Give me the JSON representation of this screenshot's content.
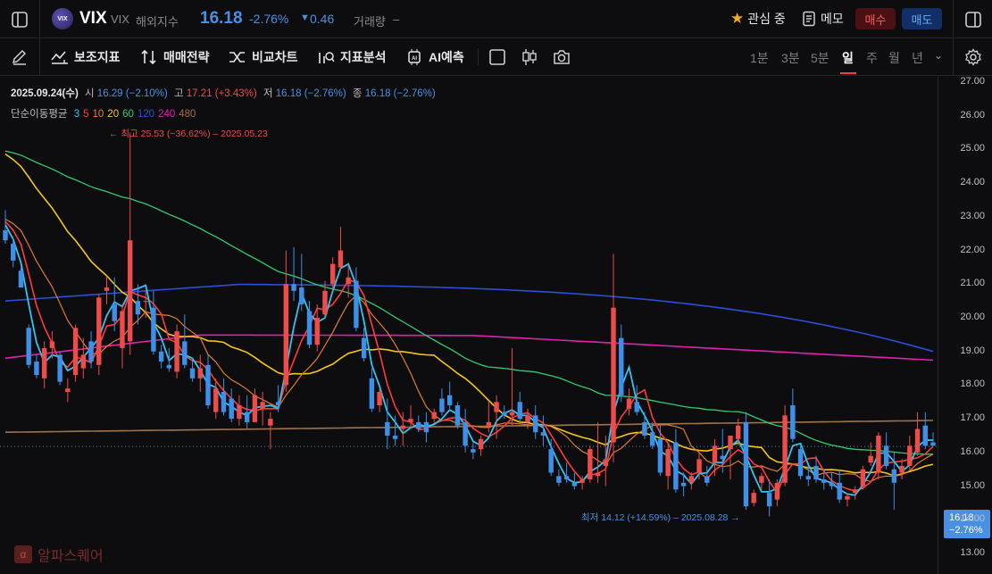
{
  "header": {
    "logo_text": "VIX",
    "symbol": "VIX",
    "symbol_sub": "VIX",
    "market": "해외지수",
    "price": "16.18",
    "change_pct": "-2.76%",
    "change_arrow": "▼",
    "change_abs": "0.46",
    "volume_label": "거래량",
    "volume_value": "–",
    "watch_label": "관심 중",
    "memo_label": "메모",
    "buy_label": "매수",
    "sell_label": "매도"
  },
  "toolbar": {
    "tools": [
      "보조지표",
      "매매전략",
      "비교차트",
      "지표분석",
      "AI예측"
    ],
    "periods": [
      "1분",
      "3분",
      "5분",
      "일",
      "주",
      "월",
      "년"
    ],
    "active_period": "일"
  },
  "ohlc": {
    "date": "2025.09.24(수)",
    "open_label": "시",
    "open": "16.29 (−2.10%)",
    "high_label": "고",
    "high": "17.21 (+3.43%)",
    "low_label": "저",
    "low": "16.18 (−2.76%)",
    "close_label": "종",
    "close": "16.18 (−2.76%)"
  },
  "ma_legend": {
    "label": "단순이동평균",
    "periods": [
      {
        "p": "3",
        "color": "#33c3f0"
      },
      {
        "p": "5",
        "color": "#ff3b3b"
      },
      {
        "p": "10",
        "color": "#e07b30"
      },
      {
        "p": "20",
        "color": "#f5c518"
      },
      {
        "p": "60",
        "color": "#2ecc71"
      },
      {
        "p": "120",
        "color": "#2a4fd8"
      },
      {
        "p": "240",
        "color": "#e020b0"
      },
      {
        "p": "480",
        "color": "#a0724a"
      }
    ]
  },
  "annotations": {
    "high": "← 최고 25.53 (−36.62%) – 2025.05.23",
    "low": "최저 14.12 (+14.59%) – 2025.08.28 →"
  },
  "price_tag": {
    "price": "16.18",
    "pct": "−2.76%"
  },
  "watermark": {
    "logo": "α",
    "text": "알파스퀘어"
  },
  "colors": {
    "up": "#ee4b4b",
    "down": "#3d8fe8",
    "bg": "#0d0d0f"
  },
  "chart_data": {
    "type": "candlestick",
    "y_ticks": [
      "27.00",
      "26.00",
      "25.00",
      "24.00",
      "23.00",
      "22.00",
      "21.00",
      "20.00",
      "19.00",
      "18.00",
      "17.00",
      "16.00",
      "15.00",
      "14.00",
      "13.00"
    ],
    "ylim": [
      12.8,
      27.3
    ],
    "grid": false,
    "candles": [
      [
        22.6,
        23.2,
        22.2,
        22.3
      ],
      [
        22.2,
        22.4,
        21.5,
        21.7
      ],
      [
        21.4,
        21.5,
        20.9,
        20.9
      ],
      [
        19.7,
        19.8,
        18.5,
        18.6
      ],
      [
        18.7,
        18.9,
        18.2,
        18.3
      ],
      [
        18.2,
        19.3,
        17.9,
        19.1
      ],
      [
        19.1,
        19.6,
        18.8,
        19.3
      ],
      [
        18.9,
        19.0,
        18.0,
        18.1
      ],
      [
        17.8,
        18.2,
        17.5,
        17.9
      ],
      [
        18.3,
        19.8,
        18.1,
        19.7
      ],
      [
        18.5,
        19.4,
        18.2,
        18.9
      ],
      [
        19.3,
        19.6,
        18.5,
        18.7
      ],
      [
        18.6,
        20.7,
        18.3,
        20.6
      ],
      [
        20.8,
        21.2,
        20.4,
        20.9
      ],
      [
        20.4,
        21.2,
        19.6,
        19.9
      ],
      [
        19.1,
        20.4,
        18.5,
        20.2
      ],
      [
        19.3,
        25.5,
        18.9,
        22.3
      ],
      [
        20.5,
        21.0,
        19.8,
        20.1
      ],
      [
        20.5,
        20.8,
        20.0,
        20.5
      ],
      [
        20.3,
        20.8,
        18.9,
        19.0
      ],
      [
        19.0,
        19.2,
        18.5,
        18.7
      ],
      [
        18.6,
        19.1,
        18.4,
        18.5
      ],
      [
        18.4,
        19.8,
        18.2,
        19.6
      ],
      [
        19.3,
        20.1,
        18.5,
        18.6
      ],
      [
        18.5,
        18.8,
        18.1,
        18.2
      ],
      [
        18.2,
        18.9,
        17.8,
        18.5
      ],
      [
        18.6,
        18.9,
        17.3,
        17.4
      ],
      [
        17.2,
        18.2,
        17.0,
        17.9
      ],
      [
        17.8,
        18.2,
        17.1,
        17.2
      ],
      [
        17.6,
        17.9,
        16.9,
        17.0
      ],
      [
        17.0,
        17.7,
        16.8,
        17.4
      ],
      [
        17.2,
        17.7,
        16.7,
        16.9
      ],
      [
        16.9,
        17.9,
        16.9,
        17.7
      ],
      [
        17.3,
        17.8,
        16.8,
        17.5
      ],
      [
        16.8,
        17.2,
        16.1,
        17.0
      ],
      [
        17.5,
        18.0,
        17.2,
        17.4
      ],
      [
        18.0,
        22.0,
        17.8,
        21.0
      ],
      [
        21.0,
        22.1,
        20.5,
        20.8
      ],
      [
        20.9,
        21.9,
        20.2,
        20.4
      ],
      [
        20.2,
        20.5,
        19.1,
        19.2
      ],
      [
        19.2,
        20.4,
        19.0,
        20.0
      ],
      [
        20.1,
        21.1,
        20.0,
        20.8
      ],
      [
        21.0,
        21.8,
        20.8,
        21.6
      ],
      [
        21.5,
        22.7,
        21.4,
        22.0
      ],
      [
        21.0,
        21.6,
        20.6,
        21.2
      ],
      [
        21.1,
        21.5,
        19.6,
        19.7
      ],
      [
        19.4,
        19.7,
        18.7,
        18.8
      ],
      [
        18.2,
        18.5,
        17.2,
        17.3
      ],
      [
        17.4,
        17.9,
        17.2,
        17.8
      ],
      [
        16.9,
        17.6,
        16.1,
        16.5
      ],
      [
        16.5,
        17.1,
        16.2,
        16.4
      ],
      [
        16.7,
        17.2,
        16.2,
        16.8
      ],
      [
        16.9,
        17.4,
        16.7,
        17.0
      ],
      [
        16.9,
        17.1,
        16.6,
        16.7
      ],
      [
        16.9,
        17.2,
        16.3,
        16.6
      ],
      [
        17.0,
        17.3,
        16.9,
        17.2
      ],
      [
        17.6,
        17.9,
        17.1,
        17.2
      ],
      [
        17.7,
        18.1,
        17.3,
        17.4
      ],
      [
        17.4,
        17.5,
        16.7,
        16.8
      ],
      [
        16.9,
        17.3,
        16.0,
        16.2
      ],
      [
        16.1,
        16.3,
        15.8,
        16.0
      ],
      [
        16.1,
        16.5,
        15.9,
        16.4
      ],
      [
        16.8,
        17.5,
        16.6,
        16.9
      ],
      [
        17.2,
        17.7,
        16.4,
        17.5
      ],
      [
        17.2,
        17.4,
        17.0,
        17.1
      ],
      [
        17.1,
        19.1,
        16.8,
        17.2
      ],
      [
        17.5,
        17.8,
        16.9,
        17.0
      ],
      [
        16.9,
        17.3,
        16.7,
        17.1
      ],
      [
        17.1,
        17.4,
        16.4,
        16.6
      ],
      [
        16.6,
        17.1,
        16.2,
        16.5
      ],
      [
        16.1,
        16.4,
        15.3,
        15.4
      ],
      [
        15.3,
        15.5,
        15.0,
        15.1
      ],
      [
        15.3,
        15.7,
        15.1,
        15.2
      ],
      [
        15.1,
        15.4,
        14.9,
        15.0
      ],
      [
        15.1,
        15.3,
        14.9,
        15.2
      ],
      [
        15.2,
        16.2,
        15.1,
        16.1
      ],
      [
        15.3,
        16.9,
        15.1,
        15.4
      ],
      [
        15.6,
        16.5,
        15.0,
        15.8
      ],
      [
        16.3,
        21.9,
        15.7,
        20.3
      ],
      [
        19.4,
        19.8,
        17.5,
        17.7
      ],
      [
        17.3,
        17.9,
        17.1,
        17.6
      ],
      [
        17.5,
        18.0,
        17.1,
        17.2
      ],
      [
        16.9,
        17.2,
        16.4,
        16.5
      ],
      [
        16.6,
        16.9,
        16.1,
        16.2
      ],
      [
        16.4,
        16.8,
        15.3,
        15.4
      ],
      [
        15.3,
        16.3,
        14.9,
        16.1
      ],
      [
        16.3,
        16.7,
        14.8,
        14.9
      ],
      [
        15.1,
        15.4,
        14.7,
        15.0
      ],
      [
        15.1,
        15.4,
        14.9,
        15.3
      ],
      [
        15.4,
        16.0,
        15.2,
        15.8
      ],
      [
        15.3,
        15.6,
        15.0,
        15.1
      ],
      [
        15.7,
        16.4,
        15.3,
        16.2
      ],
      [
        15.9,
        16.7,
        15.4,
        15.8
      ],
      [
        16.1,
        16.5,
        15.2,
        16.5
      ],
      [
        16.4,
        17.0,
        16.2,
        16.8
      ],
      [
        16.9,
        17.2,
        14.3,
        14.4
      ],
      [
        14.5,
        14.9,
        14.4,
        14.8
      ],
      [
        15.1,
        15.4,
        14.9,
        15.3
      ],
      [
        14.8,
        15.2,
        14.1,
        14.4
      ],
      [
        14.6,
        15.2,
        14.4,
        15.1
      ],
      [
        15.1,
        17.4,
        15.0,
        17.1
      ],
      [
        17.4,
        17.9,
        16.3,
        16.4
      ],
      [
        16.1,
        16.2,
        15.2,
        15.3
      ],
      [
        15.3,
        15.6,
        15.0,
        15.2
      ],
      [
        15.6,
        15.9,
        15.1,
        15.2
      ],
      [
        15.2,
        15.5,
        14.9,
        15.1
      ],
      [
        15.1,
        15.4,
        14.9,
        15.0
      ],
      [
        15.1,
        15.5,
        14.5,
        14.6
      ],
      [
        14.6,
        14.8,
        14.4,
        14.7
      ],
      [
        14.8,
        15.0,
        14.6,
        14.9
      ],
      [
        15.0,
        15.6,
        14.9,
        15.5
      ],
      [
        15.7,
        16.3,
        15.6,
        15.9
      ],
      [
        15.4,
        16.6,
        15.2,
        16.5
      ],
      [
        16.2,
        16.6,
        15.5,
        15.6
      ],
      [
        15.5,
        16.0,
        14.3,
        15.1
      ],
      [
        15.4,
        15.8,
        15.2,
        15.6
      ],
      [
        15.6,
        16.5,
        15.5,
        16.2
      ],
      [
        16.0,
        17.2,
        15.9,
        16.7
      ],
      [
        16.8,
        17.2,
        16.1,
        16.2
      ],
      [
        16.3,
        16.6,
        16.2,
        16.2
      ]
    ],
    "ma_levels": {
      "120": [
        20.5,
        19.0
      ],
      "240": [
        18.8,
        18.75
      ],
      "480": [
        16.6,
        16.95
      ]
    },
    "current": 16.18,
    "high_marker": {
      "value": 25.53,
      "date": "2025.05.23"
    },
    "low_marker": {
      "value": 14.12,
      "date": "2025.08.28"
    }
  }
}
